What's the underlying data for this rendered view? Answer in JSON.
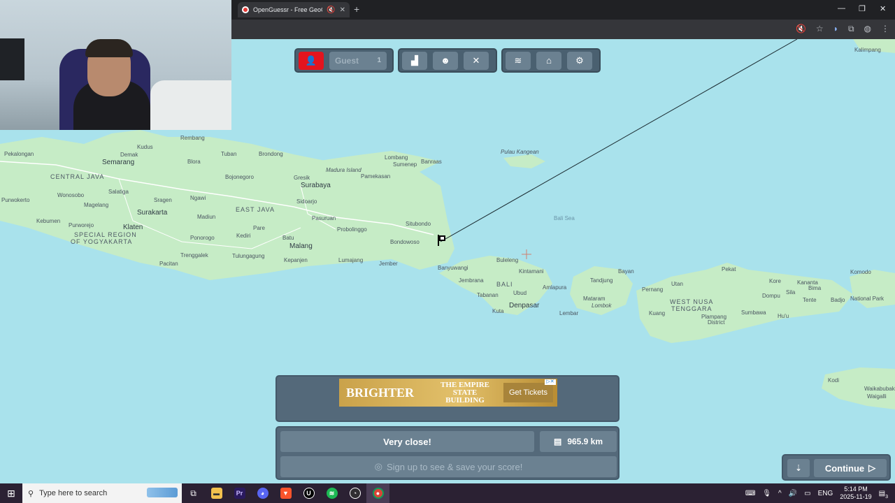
{
  "browser": {
    "tab_title": "OpenGuessr - Free GeoGuessr",
    "new_tab_icon": "plus-icon",
    "window_controls": [
      "—",
      "❐",
      "✕"
    ]
  },
  "toolbar": {
    "guest_label": "Guest",
    "guest_count": "1"
  },
  "map": {
    "labels": {
      "kalimpang": "Kalimpang",
      "pekalongan": "Pekalongan",
      "semarang": "Semarang",
      "kudus": "Kudus",
      "rembang": "Rembang",
      "tuban": "Tuban",
      "brondong": "Brondong",
      "demak": "Demak",
      "blora": "Blora",
      "bojonegoro": "Bojonegoro",
      "central_java": "CENTRAL JAVA",
      "salatiga": "Salatiga",
      "wonosobo": "Wonosobo",
      "purwokerto": "Purwokerto",
      "magelang": "Magelang",
      "surakarta": "Surakarta",
      "sragen": "Sragen",
      "ngawi": "Ngawi",
      "east_java": "EAST JAVA",
      "kebumen": "Kebumen",
      "purworejo": "Purworejo",
      "klaten": "Klaten",
      "madiun": "Madiun",
      "special_region": "SPECIAL REGION",
      "of_yogyakarta": "OF YOGYAKARTA",
      "ponorogo": "Ponorogo",
      "pare": "Pare",
      "kediri": "Kediri",
      "pacitan": "Pacitan",
      "trenggalek": "Trenggalek",
      "tulungagung": "Tulungagung",
      "batu": "Batu",
      "malang": "Malang",
      "kepanjen": "Kepanjen",
      "lumajang": "Lumajang",
      "gresik": "Gresik",
      "surabaya": "Surabaya",
      "sidoarjo": "Sidoarjo",
      "pasuruan": "Pasuruan",
      "probolinggo": "Probolinggo",
      "madura_island": "Madura Island",
      "lombang": "Lombang",
      "sumenep": "Sumenep",
      "banraas": "Banraas",
      "pamekasan": "Pamekasan",
      "pulau_kangean": "Pulau Kangean",
      "situbondo": "Situbondo",
      "bondowoso": "Bondowoso",
      "jember": "Jember",
      "bali_sea": "Bali Sea",
      "banyuwangi": "Banyuwangi",
      "jembrana": "Jembrana",
      "buleleng": "Buleleng",
      "kintamani": "Kintamani",
      "bali": "BALI",
      "ubud": "Ubud",
      "amlapura": "Amlapura",
      "tabanan": "Tabanan",
      "kuta": "Kuta",
      "denpasar": "Denpasar",
      "bayan": "Bayan",
      "tandjung": "Tandjung",
      "mataram": "Mataram",
      "lombok": "Lombok",
      "lembar": "Lembar",
      "pernang": "Pernang",
      "utan": "Utan",
      "west_nusa": "WEST NUSA",
      "tenggara": "TENGGARA",
      "kuang": "Kuang",
      "plampang": "Plampang",
      "district": "District",
      "sumbawa": "Sumbawa",
      "pekat": "Pekat",
      "kore": "Kore",
      "dompu": "Dompu",
      "sila": "Sila",
      "kananta": "Kananta",
      "bima": "Bima",
      "tente": "Tente",
      "badjo": "Badjo",
      "huu": "Hu'u",
      "komodo": "Komodo",
      "national_park": "National Park",
      "kodi": "Kodi",
      "waikabubak": "Waikabubak",
      "waigalli": "Waigalli"
    }
  },
  "ad": {
    "brighter": "BRIGHTER",
    "esb": "THE EMPIRE STATE BUILDING",
    "cta": "Get Tickets"
  },
  "result": {
    "message": "Very close!",
    "distance": "965.9 km",
    "signup": "Sign up to see & save your score!"
  },
  "continue": {
    "label": "Continue"
  },
  "taskbar": {
    "search_placeholder": "Type here to search",
    "lang": "ENG",
    "time": "5:14 PM",
    "date": "2025-11-19",
    "notification_count": "3"
  }
}
